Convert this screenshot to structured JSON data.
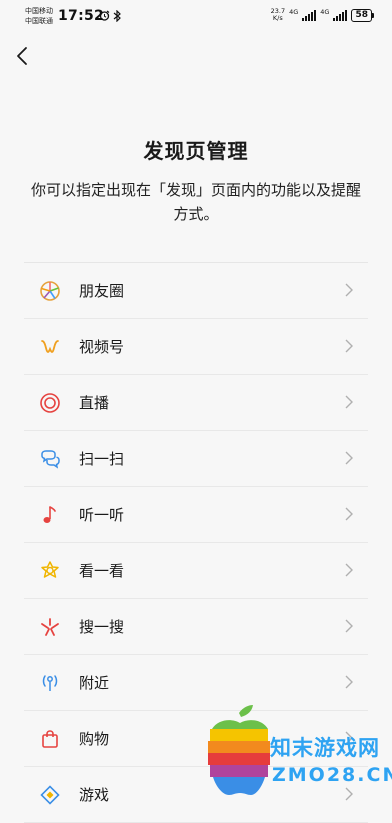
{
  "status_bar": {
    "carrier1": "中国移动",
    "carrier2": "中国联通",
    "time": "17:52",
    "speed_value": "23.7",
    "speed_unit": "K/s",
    "network1": "4G",
    "network2": "4G",
    "battery": "58"
  },
  "header": {
    "title": "发现页管理",
    "description": "你可以指定出现在「发现」页面内的功能以及提醒方式。"
  },
  "items": [
    {
      "label": "朋友圈",
      "icon": "moments-icon"
    },
    {
      "label": "视频号",
      "icon": "channels-icon"
    },
    {
      "label": "直播",
      "icon": "live-icon"
    },
    {
      "label": "扫一扫",
      "icon": "scan-icon"
    },
    {
      "label": "听一听",
      "icon": "listen-icon"
    },
    {
      "label": "看一看",
      "icon": "top-stories-icon"
    },
    {
      "label": "搜一搜",
      "icon": "search-icon"
    },
    {
      "label": "附近",
      "icon": "nearby-icon"
    },
    {
      "label": "购物",
      "icon": "shopping-icon"
    },
    {
      "label": "游戏",
      "icon": "games-icon"
    }
  ],
  "watermark": {
    "text1": "知末游戏网",
    "text2": "ZMO28.CN"
  }
}
